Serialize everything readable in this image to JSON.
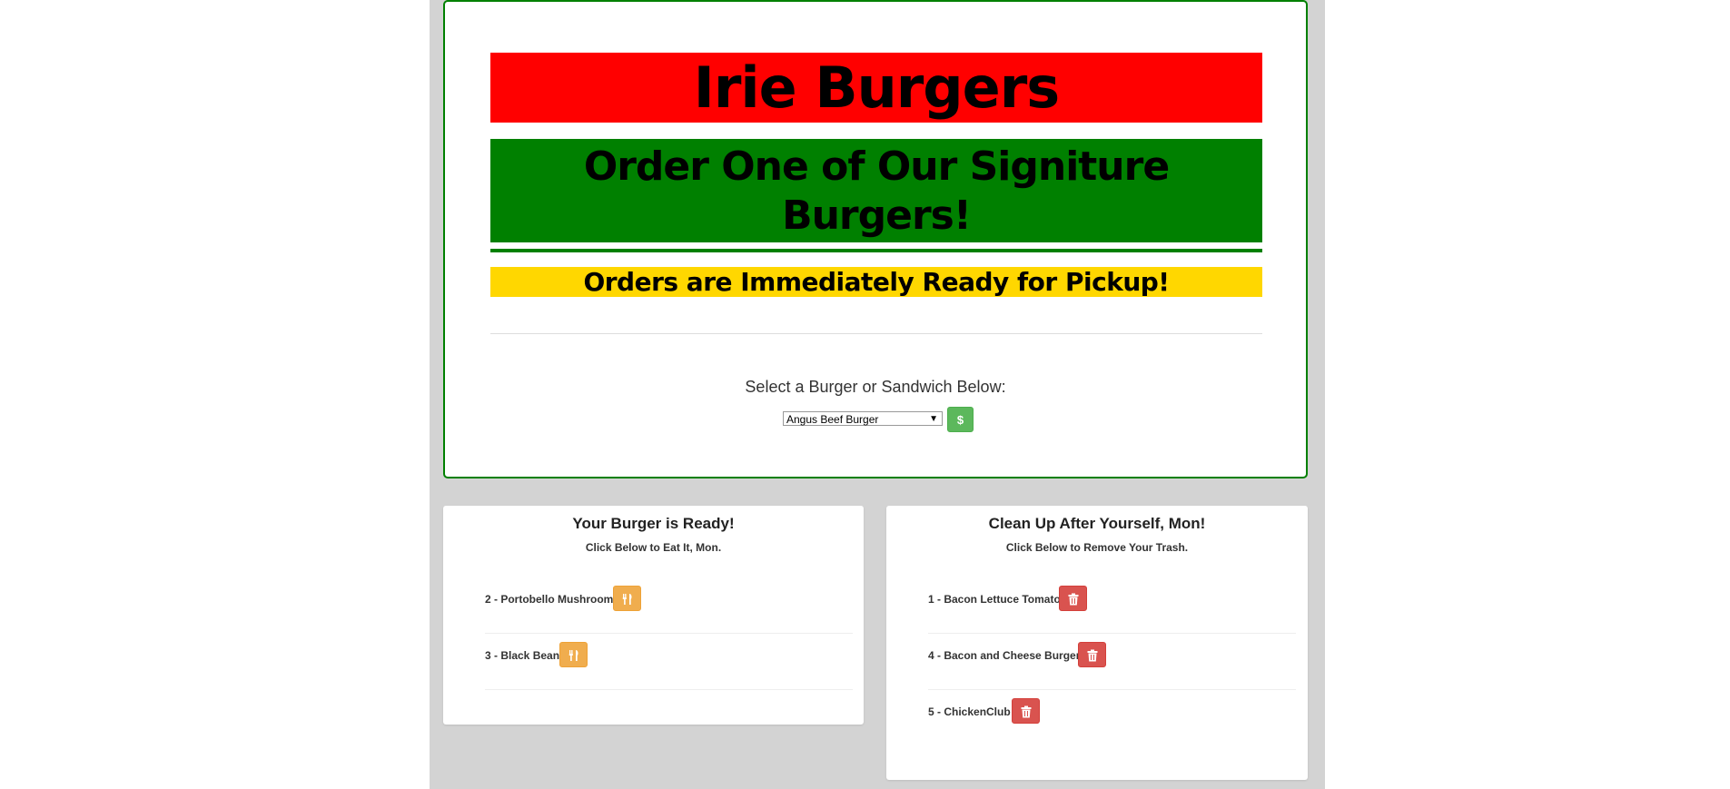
{
  "header": {
    "title": "Irie Burgers",
    "subtitle": "Order One of Our Signiture Burgers!",
    "tagline": "Orders are Immediately Ready for Pickup!"
  },
  "order": {
    "select_label": "Select a Burger or Sandwich Below:",
    "selected_option": "Angus Beef Burger",
    "buy_label": "$"
  },
  "ready_panel": {
    "title": "Your Burger is Ready!",
    "subtitle": "Click Below to Eat It, Mon.",
    "items": [
      {
        "label": "2 - Portobello Mushroom"
      },
      {
        "label": "3 - Black Bean"
      }
    ]
  },
  "trash_panel": {
    "title": "Clean Up After Yourself, Mon!",
    "subtitle": "Click Below to Remove Your Trash.",
    "items": [
      {
        "label": "1 - Bacon Lettuce Tomato"
      },
      {
        "label": "4 - Bacon and Cheese Burger"
      },
      {
        "label": "5 - ChickenClub"
      }
    ]
  },
  "colors": {
    "red": "#ff0000",
    "green": "#008000",
    "yellow": "#ffd700",
    "success": "#5cb85c",
    "warning": "#f0ad4e",
    "danger": "#d9534f"
  },
  "icons": {
    "eat": "cutlery-icon",
    "trash": "trash-icon",
    "buy": "dollar-icon"
  }
}
